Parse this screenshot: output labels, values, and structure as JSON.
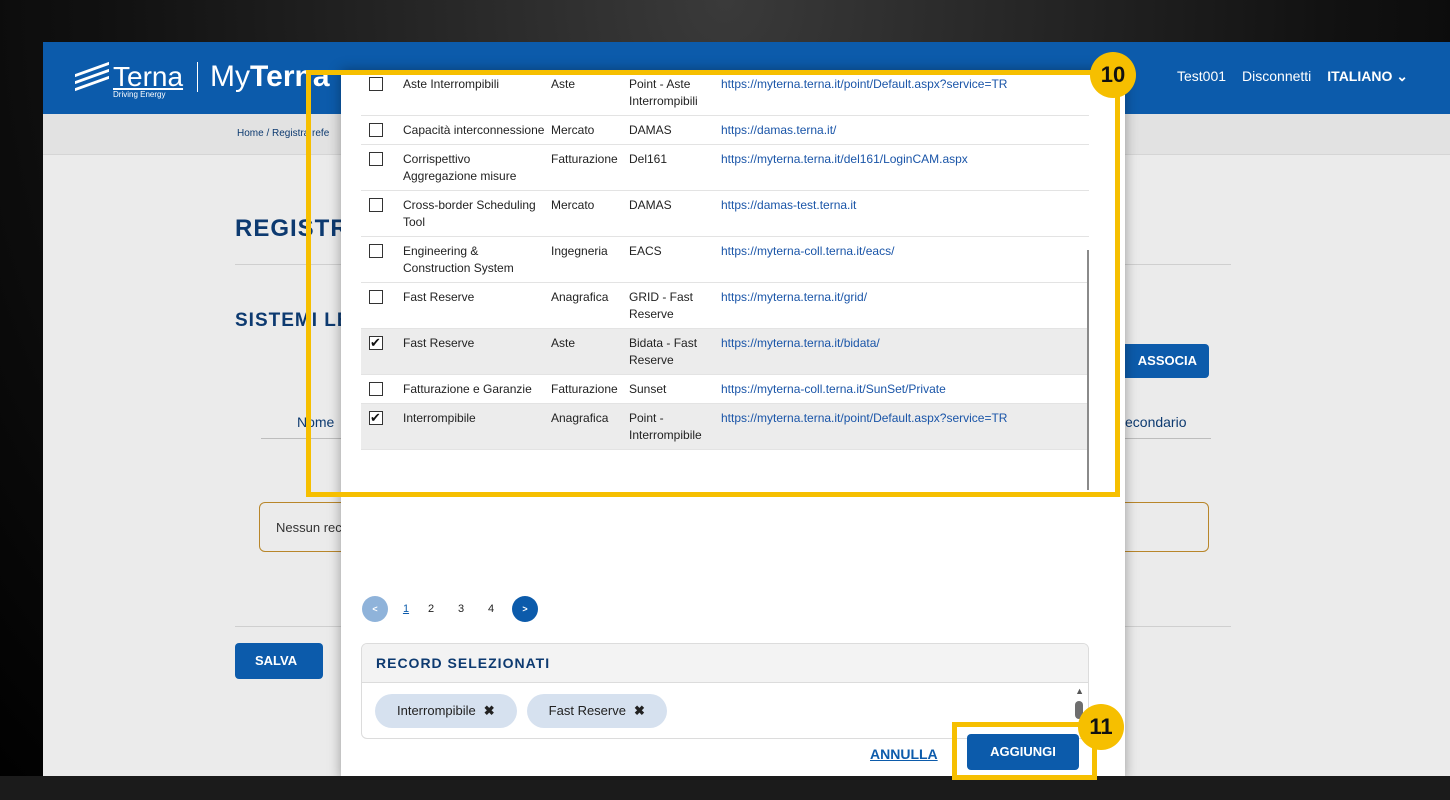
{
  "header": {
    "logo_name": "Terna",
    "logo_tagline": "Driving Energy",
    "app_prefix": "My",
    "app_name": "Terna",
    "user": "Test001",
    "logout": "Disconnetti",
    "language": "ITALIANO"
  },
  "breadcrumb": "Home / Registra refe",
  "page": {
    "title": "REGISTRA",
    "section_title": "SISTEMI LEG",
    "associa_label": "ASSOCIA",
    "col_name": "Nome",
    "col_secondary": "econdario",
    "empty_text": "Nessun rec",
    "save_label": "SALVA"
  },
  "modal": {
    "rows": [
      {
        "checked": false,
        "name": "Aste Interrompibili",
        "area": "Aste",
        "system": "Point - Aste Interrompibili",
        "url": "https://myterna.terna.it/point/Default.aspx?service=TR"
      },
      {
        "checked": false,
        "name": "Capacità interconnessione",
        "area": "Mercato",
        "system": "DAMAS",
        "url": "https://damas.terna.it/"
      },
      {
        "checked": false,
        "name": "Corrispettivo Aggregazione misure",
        "area": "Fatturazione",
        "system": "Del161",
        "url": "https://myterna.terna.it/del161/LoginCAM.aspx"
      },
      {
        "checked": false,
        "name": "Cross-border Scheduling Tool",
        "area": "Mercato",
        "system": "DAMAS",
        "url": "https://damas-test.terna.it"
      },
      {
        "checked": false,
        "name": "Engineering & Construction System",
        "area": "Ingegneria",
        "system": "EACS",
        "url": "https://myterna-coll.terna.it/eacs/"
      },
      {
        "checked": false,
        "name": "Fast Reserve",
        "area": "Anagrafica",
        "system": "GRID - Fast Reserve",
        "url": "https://myterna.terna.it/grid/"
      },
      {
        "checked": true,
        "name": "Fast Reserve",
        "area": "Aste",
        "system": "Bidata - Fast Reserve",
        "url": "https://myterna.terna.it/bidata/"
      },
      {
        "checked": false,
        "name": "Fatturazione e Garanzie",
        "area": "Fatturazione",
        "system": "Sunset",
        "url": "https://myterna-coll.terna.it/SunSet/Private"
      },
      {
        "checked": true,
        "name": "Interrompibile",
        "area": "Anagrafica",
        "system": "Point - Interrompibile",
        "url": "https://myterna.terna.it/point/Default.aspx?service=TR"
      }
    ],
    "pager": {
      "prev": "<",
      "pages": [
        "1",
        "2",
        "3",
        "4"
      ],
      "current": "1",
      "next": ">"
    },
    "selected_title": "RECORD SELEZIONATI",
    "chips": [
      "Interrompibile",
      "Fast Reserve"
    ],
    "chip_remove": "✖",
    "cancel_label": "ANNULLA",
    "add_label": "AGGIUNGI"
  },
  "callouts": {
    "list": "10",
    "add": "11"
  },
  "colors": {
    "brand_blue": "#0c5bab",
    "highlight": "#f6bf00",
    "title_navy": "#0d3a70"
  }
}
